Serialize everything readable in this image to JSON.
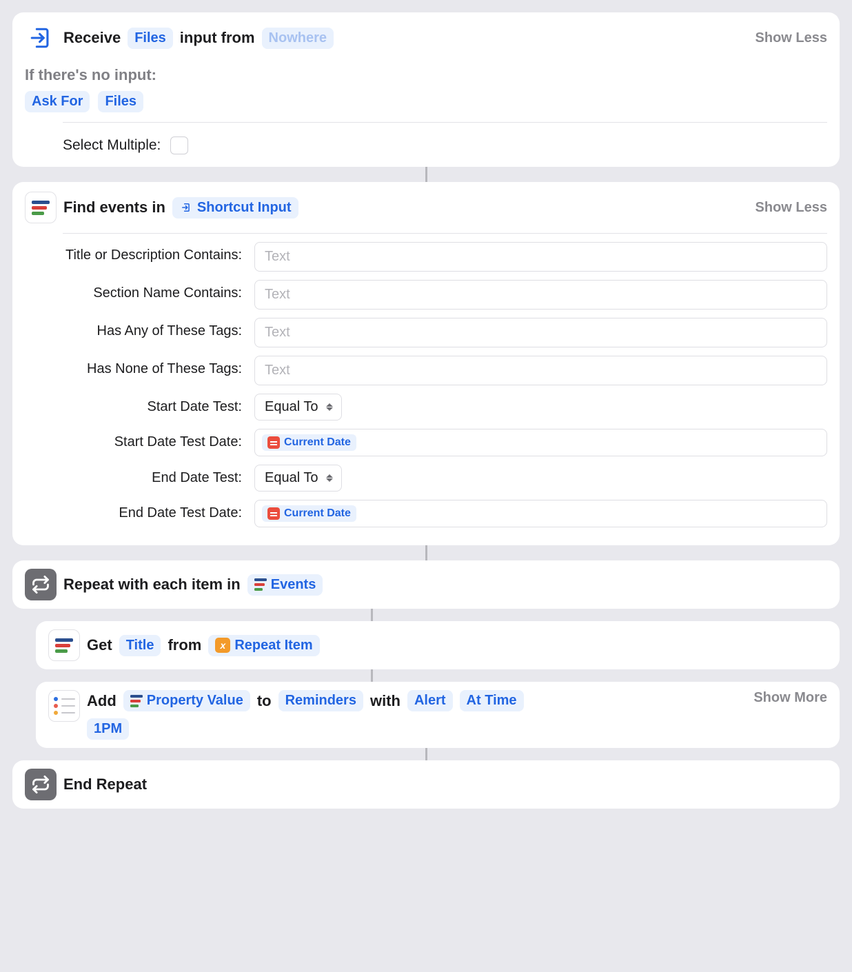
{
  "block1": {
    "receive": "Receive",
    "files": "Files",
    "input_from": "input from",
    "nowhere": "Nowhere",
    "show_less": "Show Less",
    "if_no_input": "If there's no input:",
    "ask_for": "Ask For",
    "files2": "Files",
    "select_multiple": "Select Multiple:"
  },
  "block2": {
    "find_events_in": "Find events in",
    "shortcut_input": "Shortcut Input",
    "show_less": "Show Less",
    "params": {
      "title_desc": "Title or Description Contains:",
      "section_name": "Section Name Contains:",
      "has_any_tags": "Has Any of These Tags:",
      "has_none_tags": "Has None of These Tags:",
      "start_date_test": "Start Date Test:",
      "start_date_test_date": "Start Date Test Date:",
      "end_date_test": "End Date Test:",
      "end_date_test_date": "End Date Test Date:"
    },
    "placeholder": "Text",
    "equal_to": "Equal To",
    "current_date": "Current Date"
  },
  "block3": {
    "repeat_with": "Repeat with each item in",
    "events": "Events"
  },
  "block4": {
    "get": "Get",
    "title": "Title",
    "from": "from",
    "repeat_item": "Repeat Item"
  },
  "block5": {
    "add": "Add",
    "property_value": "Property Value",
    "to": "to",
    "reminders": "Reminders",
    "with": "with",
    "alert": "Alert",
    "at_time": "At Time",
    "one_pm": "1PM",
    "show_more": "Show More"
  },
  "block6": {
    "end_repeat": "End Repeat"
  }
}
